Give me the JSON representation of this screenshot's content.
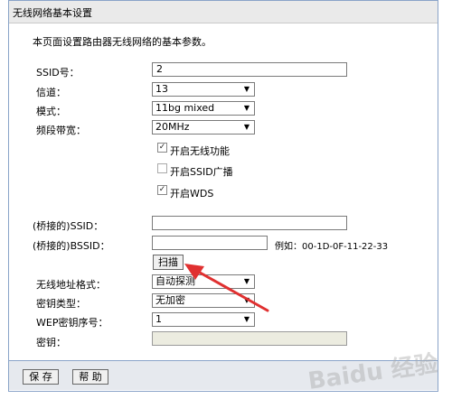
{
  "header": {
    "title": "无线网络基本设置"
  },
  "intro": "本页面设置路由器无线网络的基本参数。",
  "fields": {
    "ssid": {
      "label": "SSID号：",
      "value": "2"
    },
    "channel": {
      "label": "信道：",
      "value": "13"
    },
    "mode": {
      "label": "模式：",
      "value": "11bg mixed"
    },
    "bandwidth": {
      "label": "频段带宽：",
      "value": "20MHz"
    }
  },
  "checkboxes": {
    "enable_wireless": {
      "label": "开启无线功能",
      "checked": true
    },
    "enable_ssid_broadcast": {
      "label": "开启SSID广播",
      "checked": false
    },
    "enable_wds": {
      "label": "开启WDS",
      "checked": true
    }
  },
  "wds": {
    "bridged_ssid_label": "(桥接的)SSID：",
    "bridged_ssid_value": "",
    "bridged_bssid_label": "(桥接的)BSSID：",
    "bridged_bssid_value": "",
    "bssid_example": "例如：00-1D-0F-11-22-33",
    "scan_button": "扫描"
  },
  "security": {
    "address_format_label": "无线地址格式：",
    "address_format_value": "自动探测",
    "key_type_label": "密钥类型：",
    "key_type_value": "无加密",
    "wep_index_label": "WEP密钥序号：",
    "wep_index_value": "1",
    "key_label": "密钥：",
    "key_value": ""
  },
  "footer": {
    "save_label": "保 存",
    "help_label": "帮 助"
  },
  "watermark": "Baidu 经验",
  "icons": {
    "dropdown": "triangle-down",
    "check": "checkmark",
    "annotation": "red-arrow"
  },
  "colors": {
    "accent_border": "#8aa4c8",
    "annotation": "#e03030",
    "disabled_field": "#ecece0"
  }
}
